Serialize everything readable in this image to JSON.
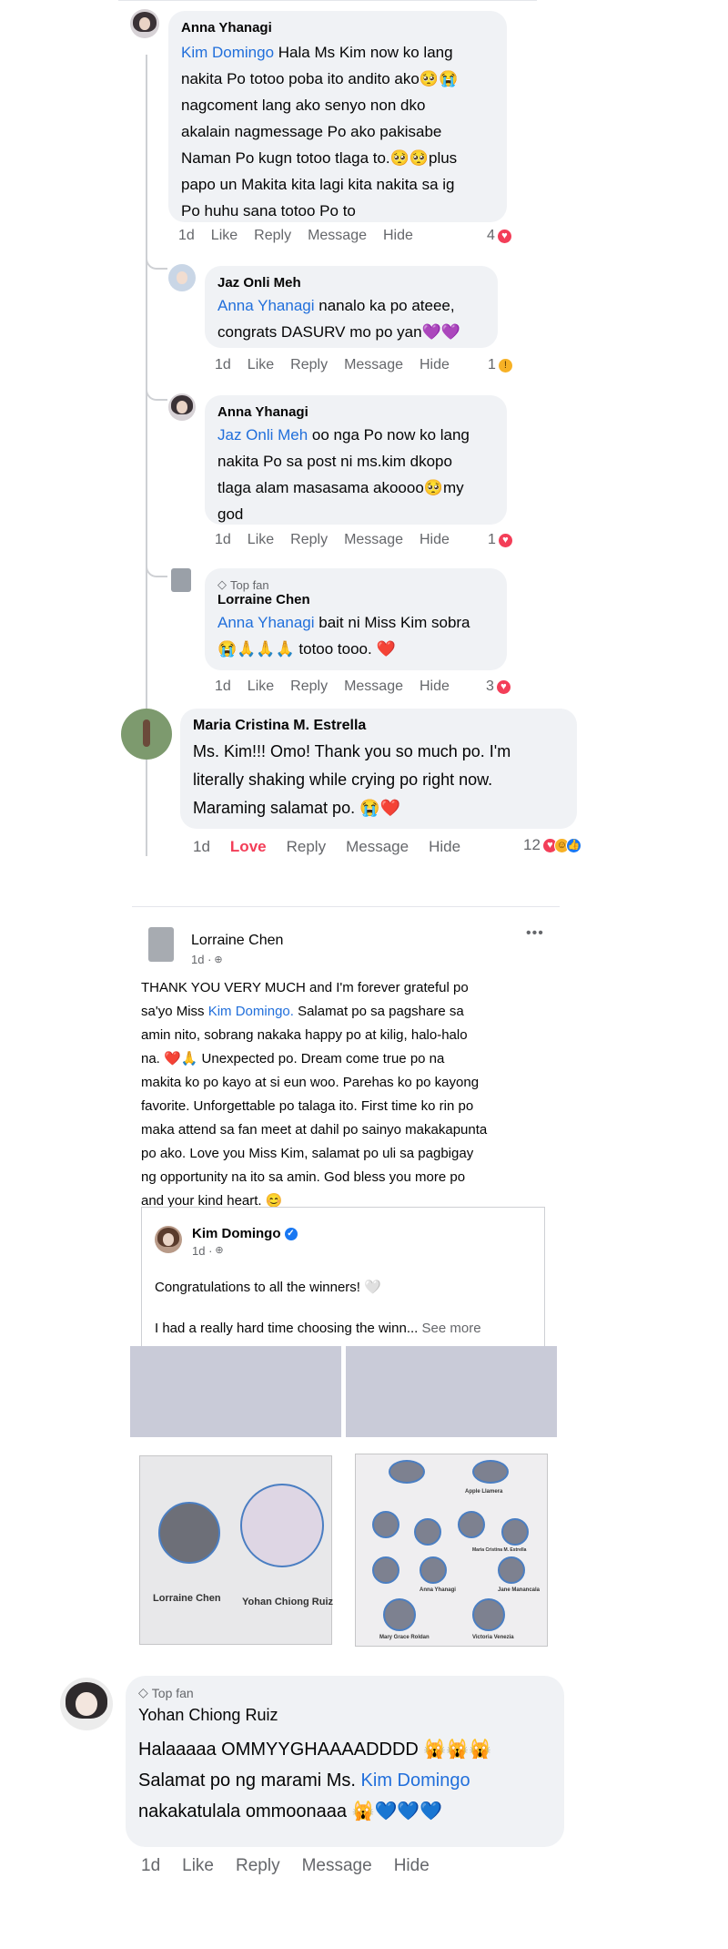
{
  "comments": [
    {
      "author": "Anna Yhanagi",
      "mention": "Kim Domingo",
      "lines": [
        " Hala Ms Kim now ko lang",
        "nakita Po totoo poba ito andito ako🥺😭",
        "nagcoment lang ako senyo non dko",
        "akalain nagmessage Po ako pakisabe",
        "Naman Po kugn totoo tlaga to.🥺🥺plus",
        "papo un Makita kita lagi kita nakita sa ig",
        "Po huhu sana totoo Po to"
      ],
      "time": "1d",
      "like": "Like",
      "reply": "Reply",
      "message": "Message",
      "hide": "Hide",
      "reaction_count": "4"
    },
    {
      "author": "Jaz Onli Meh",
      "mention": "Anna Yhanagi",
      "lines": [
        " nanalo ka po ateee,",
        "congrats DASURV mo po yan💜💜"
      ],
      "time": "1d",
      "like": "Like",
      "reply": "Reply",
      "message": "Message",
      "hide": "Hide",
      "reaction_count": "1"
    },
    {
      "author": "Anna Yhanagi",
      "mention": "Jaz Onli Meh",
      "lines": [
        " oo nga Po now ko lang",
        "nakita Po sa post ni ms.kim dkopo",
        "tlaga alam masasama akoooo🥺my",
        "god"
      ],
      "time": "1d",
      "like": "Like",
      "reply": "Reply",
      "message": "Message",
      "hide": "Hide",
      "reaction_count": "1"
    },
    {
      "badge": "Top fan",
      "author": "Lorraine Chen",
      "mention": "Anna Yhanagi",
      "lines": [
        " bait ni Miss Kim sobra",
        "😭🙏🙏🙏  totoo tooo. ❤️"
      ],
      "time": "1d",
      "like": "Like",
      "reply": "Reply",
      "message": "Message",
      "hide": "Hide",
      "reaction_count": "3"
    },
    {
      "author": "Maria Cristina M. Estrella",
      "lines": [
        "Ms. Kim!!! Omo! Thank you so much po. I'm",
        "literally shaking while crying po right now.",
        "Maraming salamat po. 😭❤️"
      ],
      "time": "1d",
      "like": "Love",
      "reply": "Reply",
      "message": "Message",
      "hide": "Hide",
      "reaction_count": "12"
    }
  ],
  "post": {
    "author": "Lorraine Chen",
    "time": "1d ·",
    "more": "•••",
    "body_lines": [
      "THANK YOU VERY MUCH and I'm forever grateful po",
      "sa'yo Miss ",
      " Salamat po sa pagshare sa",
      "amin nito, sobrang nakaka happy po at kilig, halo-halo",
      "na. ❤️🙏 Unexpected po. Dream come true po na",
      "makita ko po kayo at si eun woo. Parehas ko po kayong",
      "favorite. Unforgettable po talaga ito. First time ko rin po",
      "maka attend sa fan meet at dahil po sainyo makakapunta",
      "po ako. Love you Miss Kim, salamat po uli sa pagbigay",
      "ng opportunity na ito sa amin. God bless you more po",
      "and your kind heart. 😊"
    ],
    "body_mention": "Kim Domingo.",
    "shared": {
      "author": "Kim Domingo",
      "time": "1d ·",
      "line1": "Congratulations to all the winners! 🤍",
      "line2": "I had a really hard time choosing the winn...",
      "see_more": " See more"
    },
    "photo_left_names": [
      "Lorraine Chen",
      "Yohan Chiong Ruiz"
    ],
    "photo_right_names": [
      "Apple Llamera",
      "Maria Cristina M. Estrella",
      "Anna Yhanagi",
      "Jane Manancala",
      "Mary Grace Roldan",
      "Victoria Venezia"
    ]
  },
  "last_comment": {
    "badge": "Top fan",
    "author": "Yohan Chiong Ruiz",
    "line1": "Halaaaaa OMMYYGHAAAADDDD 🙀🙀🙀",
    "line2_prefix": "Salamat po ng marami Ms. ",
    "line2_mention": "Kim Domingo",
    "line3": "nakakatulala ommoonaaa 🙀💙💙💙",
    "time": "1d",
    "like": "Like",
    "reply": "Reply",
    "message": "Message",
    "hide": "Hide"
  },
  "colors": {
    "mention": "#216fdb",
    "heart": "#f33e58",
    "like": "#1877f2",
    "bubble": "#f0f2f5"
  }
}
